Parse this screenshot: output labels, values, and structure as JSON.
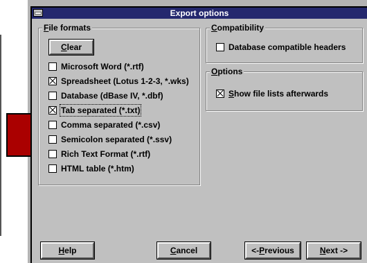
{
  "dialog": {
    "title": "Export options"
  },
  "file_formats": {
    "label_accel": "F",
    "label_rest": "ile formats",
    "clear_accel": "C",
    "clear_rest": "lear",
    "items": [
      {
        "label": "Microsoft Word (*.rtf)",
        "checked": false
      },
      {
        "label": "Spreadsheet (Lotus 1-2-3, *.wks)",
        "checked": true
      },
      {
        "label": "Database (dBase IV, *.dbf)",
        "checked": false
      },
      {
        "label": "Tab separated (*.txt)",
        "checked": true
      },
      {
        "label": "Comma separated (*.csv)",
        "checked": false
      },
      {
        "label": "Semicolon separated (*.ssv)",
        "checked": false
      },
      {
        "label": "Rich Text Format (*.rtf)",
        "checked": false
      },
      {
        "label": "HTML table (*.htm)",
        "checked": false
      }
    ]
  },
  "compatibility": {
    "label_accel": "C",
    "label_rest": "ompatibility",
    "option_label": "Database compatible headers",
    "option_checked": false
  },
  "options": {
    "label_accel": "O",
    "label_rest": "ptions",
    "option_accel": "S",
    "option_rest": "how file lists afterwards",
    "option_checked": true
  },
  "buttons": {
    "help_accel": "H",
    "help_rest": "elp",
    "cancel_accel": "C",
    "cancel_rest": "ancel",
    "prev_prefix": "<- ",
    "prev_accel": "P",
    "prev_rest": "revious",
    "next_accel": "N",
    "next_rest": "ext ->"
  },
  "colors": {
    "titlebar": "#24286e",
    "dialog": "#c0c0c0",
    "accent_red": "#aa0000"
  }
}
